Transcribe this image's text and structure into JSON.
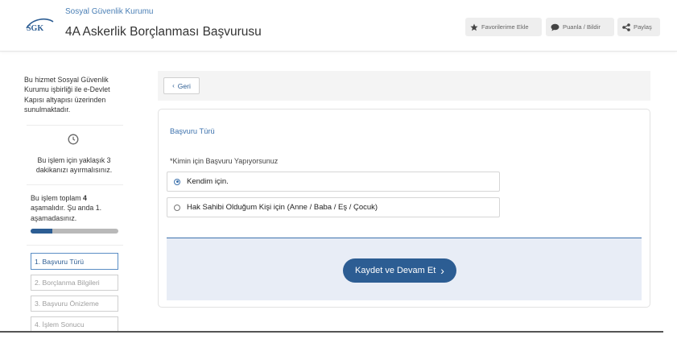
{
  "header": {
    "org_name": "Sosyal Güvenlik Kurumu",
    "logo_text": "SGK",
    "title": "4A Askerlik Borçlanması Başvurusu",
    "buttons": {
      "favorite": "Favorilerime Ekle",
      "rate": "Puanla / Bildir",
      "share": "Paylaş"
    }
  },
  "sidebar": {
    "intro": "Bu hizmet Sosyal Güvenlik Kurumu işbirliği ile e-Devlet Kapısı altyapısı üzerinden sunulmaktadır.",
    "time_note": "Bu işlem için yaklaşık 3 dakikanızı ayırmalısınız.",
    "steps_prefix": "Bu işlem toplam ",
    "steps_total": "4",
    "steps_suffix": " aşamalıdır. Şu anda 1. aşamadasınız.",
    "progress_fraction": 0.25,
    "steps": [
      "1. Başvuru Türü",
      "2. Borçlanma Bilgileri",
      "3. Başvuru Önizleme",
      "4. İşlem Sonucu"
    ]
  },
  "main": {
    "back_label": "Geri",
    "section_title": "Başvuru Türü",
    "question": "*Kimin için Başvuru Yapıyorsunuz",
    "options": [
      {
        "label": "Kendim için.",
        "selected": true
      },
      {
        "label": "Hak Sahibi Olduğum Kişi için (Anne / Baba / Eş / Çocuk)",
        "selected": false
      }
    ],
    "submit_label": "Kaydet ve Devam Et"
  },
  "colors": {
    "primary": "#2c5d93",
    "accent": "#3d72ad",
    "action_bg": "#e8edf6"
  }
}
